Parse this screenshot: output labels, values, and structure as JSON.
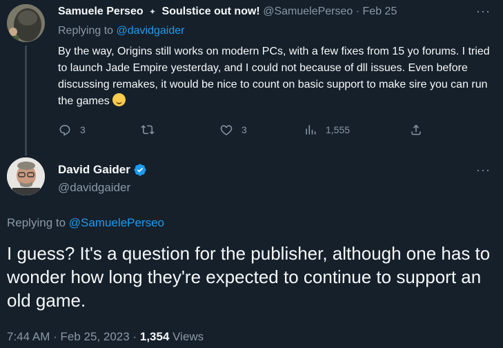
{
  "reply": {
    "author_name": "Samuele Perseo",
    "author_suffix": "Soulstice out now!",
    "handle": "@SamuelePerseo",
    "date": "· Feb 25",
    "replying_prefix": "Replying to",
    "replying_to": "@davidgaider",
    "body": "By the way, Origins still works on modern PCs, with a few fixes from 15 yo forums. I tried to launch Jade Empire yesterday, and I could not because of dll issues. Even before discussing remakes, it would be nice to count on basic support to make sire you can run the games",
    "emoji_icon": "grinning-sweat-emoji",
    "more": "···",
    "stats": {
      "replies": "3",
      "retweets": "",
      "likes": "3",
      "views": "1,555"
    }
  },
  "main": {
    "author_name": "David Gaider",
    "handle": "@davidgaider",
    "more": "···",
    "replying_prefix": "Replying to",
    "replying_to": "@SamuelePerseo",
    "body": "I guess? It's a question for the publisher, although one has to wonder how long they're expected to continue to support an old game.",
    "time": "7:44 AM",
    "date": "Feb 25, 2023",
    "sep": "·",
    "views_count": "1,354",
    "views_label": "Views"
  },
  "colors": {
    "background": "#15202b",
    "text": "#f7f9f9",
    "muted": "#8b98a5",
    "link": "#1d9bf0",
    "verified": "#1d9bf0"
  }
}
